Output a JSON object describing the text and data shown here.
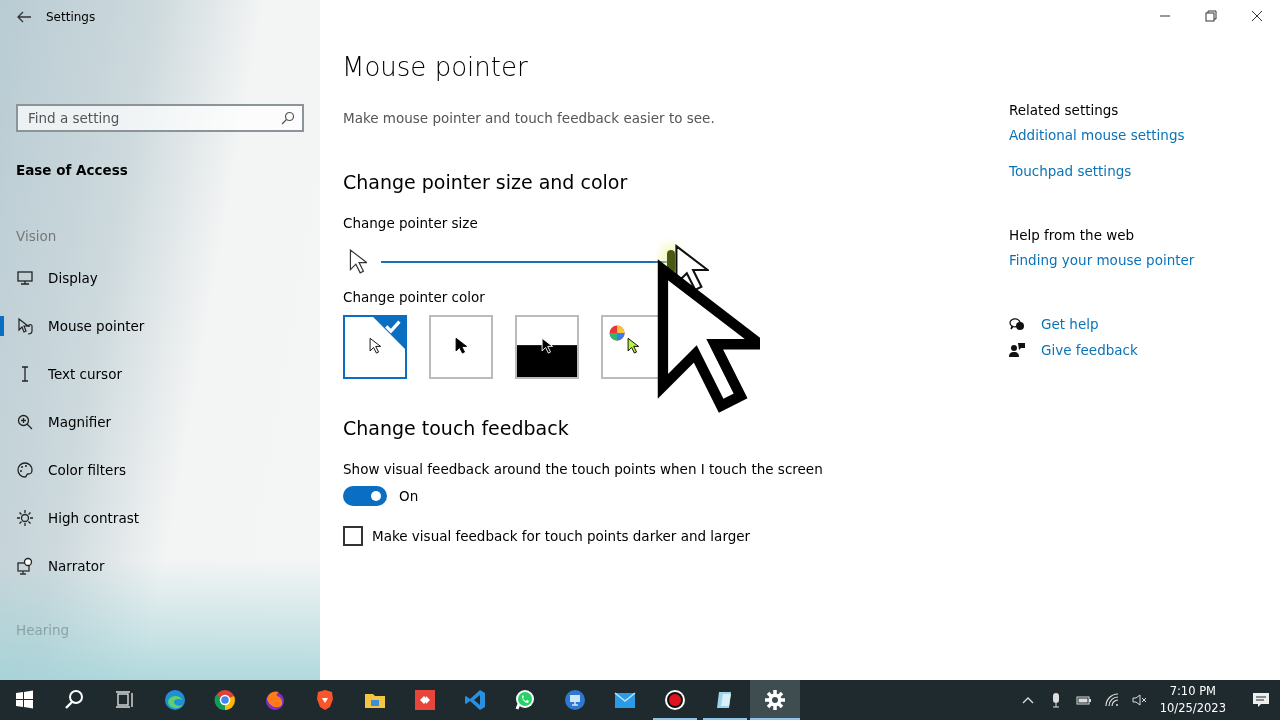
{
  "window": {
    "title": "Settings"
  },
  "sidebar": {
    "search": {
      "placeholder": "Find a setting"
    },
    "category": "Ease of Access",
    "groups": [
      {
        "heading": "Vision",
        "items": [
          {
            "label": "Display",
            "selected": false
          },
          {
            "label": "Mouse pointer",
            "selected": true
          },
          {
            "label": "Text cursor",
            "selected": false
          },
          {
            "label": "Magnifier",
            "selected": false
          },
          {
            "label": "Color filters",
            "selected": false
          },
          {
            "label": "High contrast",
            "selected": false
          },
          {
            "label": "Narrator",
            "selected": false
          }
        ]
      },
      {
        "heading": "Hearing"
      }
    ]
  },
  "page": {
    "title": "Mouse pointer",
    "description": "Make mouse pointer and touch feedback easier to see.",
    "size_section": {
      "heading": "Change pointer size and color",
      "slider_label": "Change pointer size",
      "slider": {
        "level": 1.0
      },
      "color_label": "Change pointer color",
      "color_options": [
        {
          "kind": "white",
          "selected": true
        },
        {
          "kind": "black",
          "selected": false
        },
        {
          "kind": "inverted",
          "selected": false
        },
        {
          "kind": "custom",
          "selected": false
        }
      ]
    },
    "touch_section": {
      "heading": "Change touch feedback",
      "toggle_label": "Show visual feedback around the touch points when I touch the screen",
      "toggle": {
        "on": true,
        "state_text": "On"
      },
      "checkbox": {
        "label": "Make visual feedback for touch points darker and larger",
        "checked": false
      }
    }
  },
  "related": {
    "heading": "Related settings",
    "links": [
      "Additional mouse settings",
      "Touchpad settings"
    ],
    "web_heading": "Help from the web",
    "web_links": [
      "Finding your mouse pointer"
    ],
    "help_links": [
      "Get help",
      "Give feedback"
    ]
  },
  "taskbar": {
    "apps": [
      {
        "selected": false,
        "running": false
      },
      {
        "selected": false,
        "running": false
      },
      {
        "selected": false,
        "running": false
      },
      {
        "selected": false,
        "running": false
      },
      {
        "selected": false,
        "running": false
      },
      {
        "selected": false,
        "running": false
      },
      {
        "selected": false,
        "running": false
      },
      {
        "selected": false,
        "running": false
      },
      {
        "selected": false,
        "running": false
      },
      {
        "selected": false,
        "running": false
      },
      {
        "selected": false,
        "running": false
      },
      {
        "selected": false,
        "running": false
      },
      {
        "selected": false,
        "running": false
      },
      {
        "selected": false,
        "running": true
      },
      {
        "selected": false,
        "running": true
      },
      {
        "selected": true,
        "running": true
      }
    ],
    "time": "7:10 PM",
    "date": "10/25/2023"
  }
}
